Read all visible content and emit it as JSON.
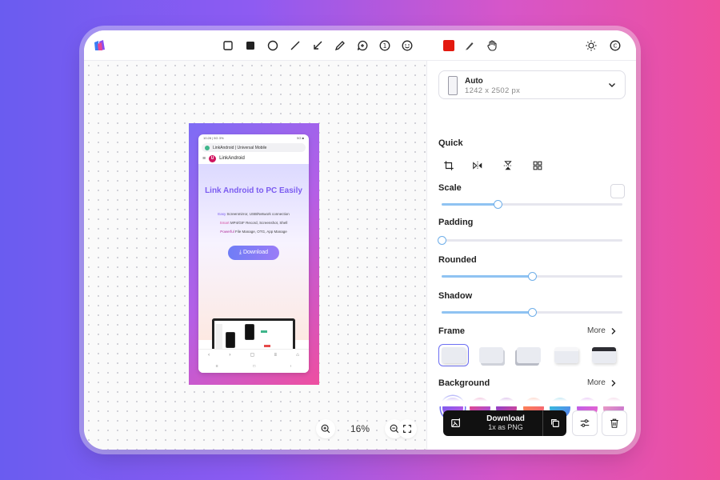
{
  "toolbar": {
    "tools": [
      "square-outline-icon",
      "square-filled-icon",
      "circle-icon",
      "line-icon",
      "arrow-icon",
      "pencil-icon",
      "speech-bubble-icon",
      "number-badge-icon",
      "emoji-icon"
    ],
    "color_swatch": "#e3190f",
    "right_icons": [
      "sun-icon",
      "copyright-icon"
    ]
  },
  "preview": {
    "status_time": "10:28 | 5G 3%",
    "status_right": "5G ■",
    "url": "LinkAndroid | Universal Mobile",
    "site_name": "LinkAndroid",
    "hero_title": "Link Android to PC Easily",
    "lines": [
      {
        "highlight": "Easy",
        "text": " Screenmirror, USB/Network connection"
      },
      {
        "highlight": "Smart",
        "text": " MP4/GIF Record, Screenshot, Shell"
      },
      {
        "highlight": "Powerful",
        "text": " File Manage, OTG, App Manage"
      }
    ],
    "download_label": "⤓ Download"
  },
  "zoom": {
    "value": "16%"
  },
  "panel": {
    "device": {
      "name": "Auto",
      "size": "1242 x 2502 px"
    },
    "quick_label": "Quick",
    "scale_label": "Scale",
    "scale_value": 0.31,
    "padding_label": "Padding",
    "padding_value": 0.0,
    "rounded_label": "Rounded",
    "rounded_value": 0.5,
    "shadow_label": "Shadow",
    "shadow_value": 0.5,
    "frame_label": "Frame",
    "frame_more": "More",
    "background_label": "Background",
    "background_more": "More",
    "background_colors": [
      "linear-gradient(135deg,#6a5cf0,#c656e0)",
      "linear-gradient(135deg,#f0467a,#9b4fe8)",
      "linear-gradient(135deg,#7a3fd8,#e0468a)",
      "linear-gradient(135deg,#ff8a4a,#f25c7c)",
      "linear-gradient(135deg,#2ec9d6,#5b7ef0)",
      "linear-gradient(135deg,#b25cf0,#f064c8)",
      "linear-gradient(135deg,#f2a6c2,#c06ad0)"
    ],
    "download": {
      "title": "Download",
      "subtitle": "1x as PNG"
    }
  }
}
